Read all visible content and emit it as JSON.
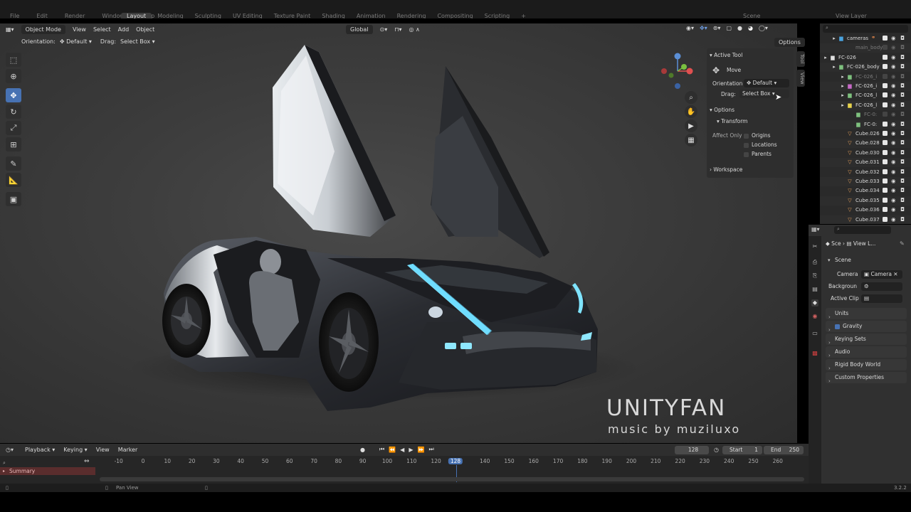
{
  "topbar": {
    "menus": [
      "File",
      "Edit",
      "Render",
      "Window",
      "Help"
    ],
    "workspaces": [
      "Layout",
      "Modeling",
      "Sculpting",
      "UV Editing",
      "Texture Paint",
      "Shading",
      "Animation",
      "Rendering",
      "Compositing",
      "Scripting"
    ],
    "add_tab": "+",
    "scene_label": "Scene",
    "viewlayer_label": "View Layer"
  },
  "viewport": {
    "mode": "Object Mode",
    "menus": [
      "View",
      "Select",
      "Add",
      "Object"
    ],
    "transform_space": "Global",
    "options_label": "Options",
    "orientation_label": "Orientation:",
    "orientation_value": "Default",
    "drag_label": "Drag:",
    "drag_value": "Select Box",
    "watermark_title": "UNITYFAN",
    "watermark_sub": "music by muziluxo"
  },
  "tool_panel": {
    "header": "Active Tool",
    "tool_name": "Move",
    "orientation_label": "Orientation",
    "orientation_value": "Default",
    "drag_label": "Drag:",
    "drag_value": "Select Box",
    "options_header": "Options",
    "transform_header": "Transform",
    "affect_only_label": "Affect Only",
    "affect_items": [
      "Origins",
      "Locations",
      "Parents"
    ],
    "workspace_header": "Workspace",
    "side_tabs": [
      "Tool",
      "View"
    ]
  },
  "outliner": {
    "rows": [
      {
        "name": "cameras",
        "icon": "collection",
        "color": "#4aa3df",
        "indent": 1,
        "dim": false
      },
      {
        "name": "main_body",
        "icon": "none",
        "color": "#888888",
        "indent": 2,
        "dim": true
      },
      {
        "name": "FC-026",
        "icon": "collection",
        "color": "#e0e0e0",
        "indent": 0,
        "dim": false
      },
      {
        "name": "FC-026_body",
        "icon": "collection",
        "color": "#7ec17e",
        "indent": 1,
        "dim": false
      },
      {
        "name": "FC-026_i",
        "icon": "collection",
        "color": "#7ec17e",
        "indent": 2,
        "dim": true
      },
      {
        "name": "FC-026_i",
        "icon": "collection",
        "color": "#c86ac8",
        "indent": 2,
        "dim": false
      },
      {
        "name": "FC-026_l",
        "icon": "collection",
        "color": "#7ec17e",
        "indent": 2,
        "dim": false
      },
      {
        "name": "FC-026_l",
        "icon": "collection",
        "color": "#e8d44d",
        "indent": 2,
        "dim": false
      },
      {
        "name": "FC-0:",
        "icon": "collection",
        "color": "#7ec17e",
        "indent": 3,
        "dim": true
      },
      {
        "name": "FC-0:",
        "icon": "collection",
        "color": "#7ec17e",
        "indent": 3,
        "dim": false
      },
      {
        "name": "Cube.026",
        "icon": "mesh",
        "color": "#e8a05a",
        "indent": 2,
        "dim": false
      },
      {
        "name": "Cube.028",
        "icon": "mesh",
        "color": "#e8a05a",
        "indent": 2,
        "dim": false
      },
      {
        "name": "Cube.030",
        "icon": "mesh",
        "color": "#e8a05a",
        "indent": 2,
        "dim": false
      },
      {
        "name": "Cube.031",
        "icon": "mesh",
        "color": "#e8a05a",
        "indent": 2,
        "dim": false
      },
      {
        "name": "Cube.032",
        "icon": "mesh",
        "color": "#e8a05a",
        "indent": 2,
        "dim": false
      },
      {
        "name": "Cube.033",
        "icon": "mesh",
        "color": "#e8a05a",
        "indent": 2,
        "dim": false
      },
      {
        "name": "Cube.034",
        "icon": "mesh",
        "color": "#e8a05a",
        "indent": 2,
        "dim": false
      },
      {
        "name": "Cube.035",
        "icon": "mesh",
        "color": "#e8a05a",
        "indent": 2,
        "dim": false
      },
      {
        "name": "Cube.036",
        "icon": "mesh",
        "color": "#e8a05a",
        "indent": 2,
        "dim": false
      },
      {
        "name": "Cube.037",
        "icon": "mesh",
        "color": "#e8a05a",
        "indent": 2,
        "dim": false
      }
    ]
  },
  "properties": {
    "breadcrumb_scene": "Sce",
    "breadcrumb_viewlayer": "View L...",
    "scene_header": "Scene",
    "camera_label": "Camera",
    "camera_value": "Camera",
    "background_label": "Backgroun",
    "active_clip_label": "Active Clip",
    "sections": [
      "Units",
      "Gravity",
      "Keying Sets",
      "Audio",
      "Rigid Body World",
      "Custom Properties"
    ]
  },
  "timeline": {
    "menus": [
      "Playback",
      "Keying",
      "View",
      "Marker"
    ],
    "current_frame": "128",
    "start_label": "Start",
    "start_value": "1",
    "end_label": "End",
    "end_value": "250",
    "ticks": [
      "-10",
      "0",
      "10",
      "20",
      "30",
      "40",
      "50",
      "60",
      "70",
      "80",
      "90",
      "100",
      "110",
      "120",
      "128",
      "140",
      "150",
      "160",
      "170",
      "180",
      "190",
      "200",
      "210",
      "220",
      "230",
      "240",
      "250",
      "260"
    ],
    "summary_label": "Summary"
  },
  "statusbar": {
    "pan_view": "Pan View",
    "version": "3.2.2"
  },
  "colors": {
    "accent": "#4772b3",
    "glow": "#5fd6ff"
  }
}
